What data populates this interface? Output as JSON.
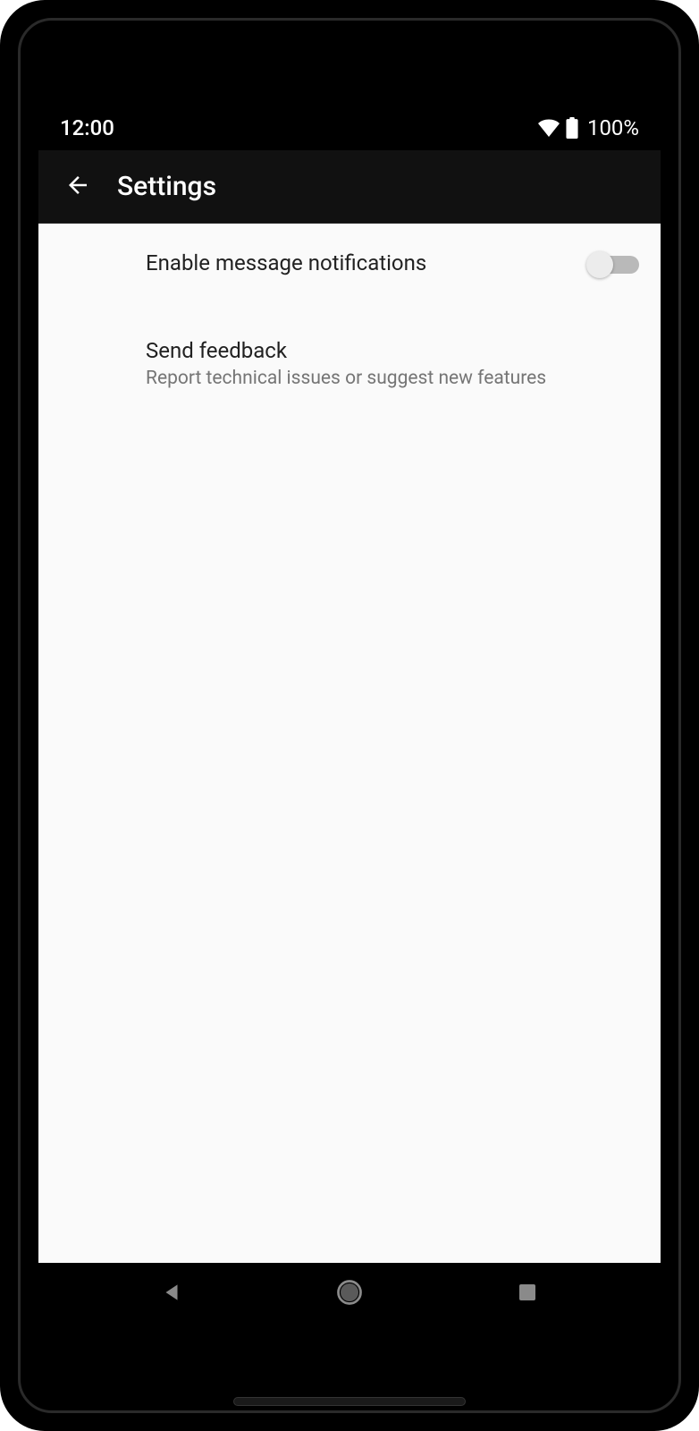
{
  "status": {
    "time": "12:00",
    "battery": "100%"
  },
  "appbar": {
    "title": "Settings"
  },
  "settings": {
    "notifications": {
      "label": "Enable message notifications",
      "enabled": false
    },
    "feedback": {
      "label": "Send feedback",
      "description": "Report technical issues or suggest new features"
    }
  }
}
